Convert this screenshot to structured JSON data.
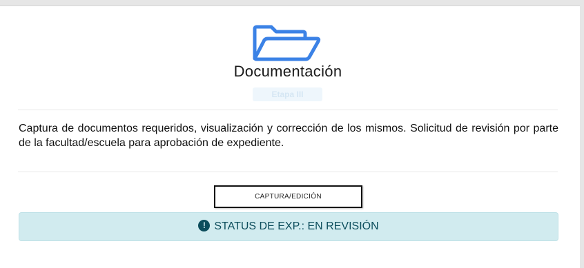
{
  "section": {
    "icon": "folder-open-icon",
    "title": "Documentación",
    "stage_badge": "Etapa III"
  },
  "description": "Captura de documentos requeridos, visualización y corrección de los mismos. Solicitud de revisión por parte de la facultad/escuela para aprobación de expediente.",
  "actions": {
    "capture_label": "CAPTURA/EDICIÓN"
  },
  "status": {
    "icon": "exclamation-circle-icon",
    "icon_glyph": "!",
    "text": "STATUS DE EXP.: EN REVISIÓN"
  },
  "colors": {
    "folder_icon": "#3b82e6",
    "status_bg": "#d1ebef",
    "status_text": "#0c4d5c"
  }
}
